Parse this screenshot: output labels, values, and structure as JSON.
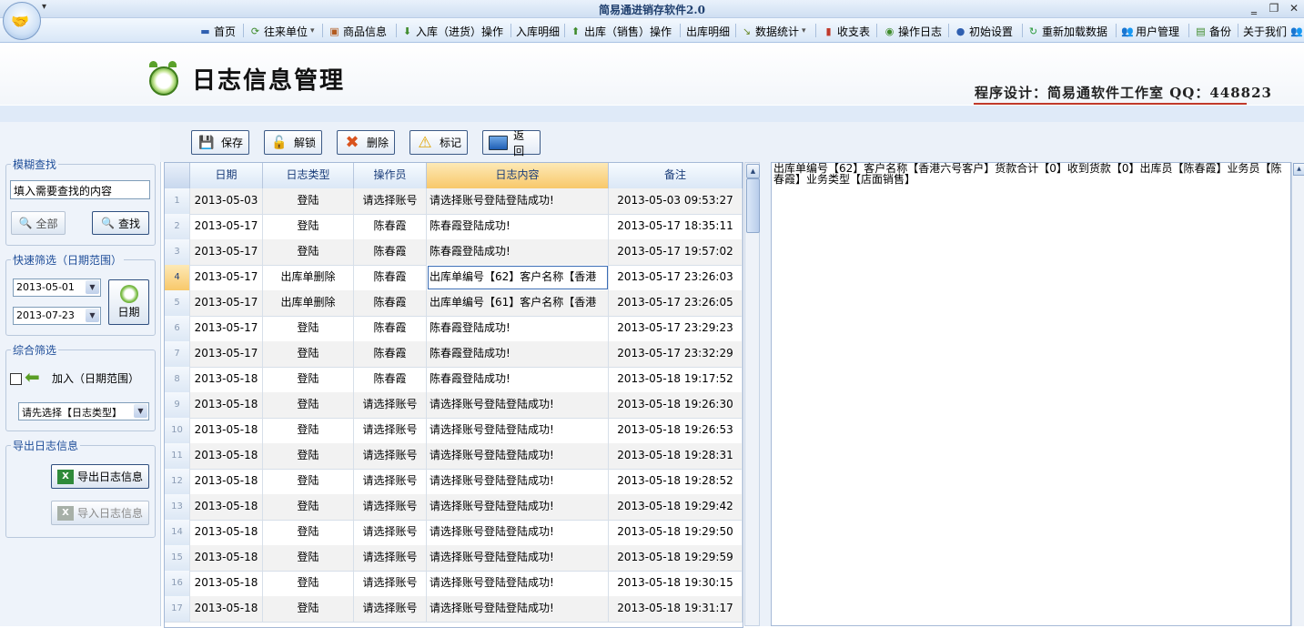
{
  "window": {
    "title": "简易通进销存软件2.0",
    "quick_access": "▾",
    "min": "‗",
    "max": "❐",
    "close": "✕"
  },
  "toolbar": {
    "items": [
      {
        "label": "首页",
        "icon": "home-icon",
        "color": "#2f5fb0"
      },
      {
        "label": "往来单位",
        "icon": "contacts-icon",
        "color": "#3d8a2a",
        "dropdown": true
      },
      {
        "label": "商品信息",
        "icon": "goods-icon",
        "color": "#b25a1e"
      },
      {
        "label": "入库（进货）操作",
        "icon": "down-arrow-icon",
        "color": "#3d8a2a"
      },
      {
        "label": "入库明细",
        "icon": "",
        "color": ""
      },
      {
        "label": "出库（销售）操作",
        "icon": "up-arrow-icon",
        "color": "#3d8a2a"
      },
      {
        "label": "出库明细",
        "icon": "",
        "color": ""
      },
      {
        "label": "数据统计",
        "icon": "stats-icon",
        "color": "#6a8a2a",
        "dropdown": true
      },
      {
        "label": "收支表",
        "icon": "bar-chart-icon",
        "color": "#c0392b"
      },
      {
        "label": "操作日志",
        "icon": "clock-icon",
        "color": "#3d8a2a"
      },
      {
        "label": "初始设置",
        "icon": "settings-icon",
        "color": "#2f5fb0"
      },
      {
        "label": "重新加载数据",
        "icon": "reload-icon",
        "color": "#2a9a3a"
      },
      {
        "label": "用户管理",
        "icon": "users-icon",
        "color": "#2f5fb0"
      },
      {
        "label": "备份",
        "icon": "backup-icon",
        "color": "#3d8a2a"
      },
      {
        "label": "关于我们",
        "icon": "",
        "color": ""
      }
    ]
  },
  "header": {
    "title": "日志信息管理",
    "credit": "程序设计：简易通软件工作室 QQ：448823"
  },
  "sidebar": {
    "fuzzy": {
      "title": "模糊查找",
      "input_value": "填入需要查找的内容",
      "all_label": "全部",
      "find_label": "查找"
    },
    "quick": {
      "title": "快速筛选（日期范围）",
      "date_from": "2013-05-01",
      "date_to": "2013-07-23",
      "date_button": "日期"
    },
    "combined": {
      "title": "综合筛选",
      "add_label": "加入（日期范围）",
      "select_value": "请先选择【日志类型】"
    },
    "export": {
      "title": "导出日志信息",
      "export_label": "导出日志信息",
      "import_label": "导入日志信息"
    }
  },
  "actions": {
    "save": "保存",
    "unlock": "解锁",
    "delete": "删除",
    "mark": "标记",
    "back": "返回"
  },
  "grid": {
    "columns": [
      "日期",
      "日志类型",
      "操作员",
      "日志内容",
      "备注"
    ],
    "rows": [
      {
        "n": "1",
        "date": "2013-05-03",
        "type": "登陆",
        "op": "请选择账号",
        "content": "请选择账号登陆登陆成功!",
        "note": "2013-05-03 09:53:27"
      },
      {
        "n": "2",
        "date": "2013-05-17",
        "type": "登陆",
        "op": "陈春霞",
        "content": "陈春霞登陆成功!",
        "note": "2013-05-17 18:35:11"
      },
      {
        "n": "3",
        "date": "2013-05-17",
        "type": "登陆",
        "op": "陈春霞",
        "content": "陈春霞登陆成功!",
        "note": "2013-05-17 19:57:02"
      },
      {
        "n": "4",
        "date": "2013-05-17",
        "type": "出库单删除",
        "op": "陈春霞",
        "content": "出库单编号【62】客户名称【香港",
        "note": "2013-05-17 23:26:03"
      },
      {
        "n": "5",
        "date": "2013-05-17",
        "type": "出库单删除",
        "op": "陈春霞",
        "content": "出库单编号【61】客户名称【香港",
        "note": "2013-05-17 23:26:05"
      },
      {
        "n": "6",
        "date": "2013-05-17",
        "type": "登陆",
        "op": "陈春霞",
        "content": "陈春霞登陆成功!",
        "note": "2013-05-17 23:29:23"
      },
      {
        "n": "7",
        "date": "2013-05-17",
        "type": "登陆",
        "op": "陈春霞",
        "content": "陈春霞登陆成功!",
        "note": "2013-05-17 23:32:29"
      },
      {
        "n": "8",
        "date": "2013-05-18",
        "type": "登陆",
        "op": "陈春霞",
        "content": "陈春霞登陆成功!",
        "note": "2013-05-18 19:17:52"
      },
      {
        "n": "9",
        "date": "2013-05-18",
        "type": "登陆",
        "op": "请选择账号",
        "content": "请选择账号登陆登陆成功!",
        "note": "2013-05-18 19:26:30"
      },
      {
        "n": "10",
        "date": "2013-05-18",
        "type": "登陆",
        "op": "请选择账号",
        "content": "请选择账号登陆登陆成功!",
        "note": "2013-05-18 19:26:53"
      },
      {
        "n": "11",
        "date": "2013-05-18",
        "type": "登陆",
        "op": "请选择账号",
        "content": "请选择账号登陆登陆成功!",
        "note": "2013-05-18 19:28:31"
      },
      {
        "n": "12",
        "date": "2013-05-18",
        "type": "登陆",
        "op": "请选择账号",
        "content": "请选择账号登陆登陆成功!",
        "note": "2013-05-18 19:28:52"
      },
      {
        "n": "13",
        "date": "2013-05-18",
        "type": "登陆",
        "op": "请选择账号",
        "content": "请选择账号登陆登陆成功!",
        "note": "2013-05-18 19:29:42"
      },
      {
        "n": "14",
        "date": "2013-05-18",
        "type": "登陆",
        "op": "请选择账号",
        "content": "请选择账号登陆登陆成功!",
        "note": "2013-05-18 19:29:50"
      },
      {
        "n": "15",
        "date": "2013-05-18",
        "type": "登陆",
        "op": "请选择账号",
        "content": "请选择账号登陆登陆成功!",
        "note": "2013-05-18 19:29:59"
      },
      {
        "n": "16",
        "date": "2013-05-18",
        "type": "登陆",
        "op": "请选择账号",
        "content": "请选择账号登陆登陆成功!",
        "note": "2013-05-18 19:30:15"
      },
      {
        "n": "17",
        "date": "2013-05-18",
        "type": "登陆",
        "op": "请选择账号",
        "content": "请选择账号登陆登陆成功!",
        "note": "2013-05-18 19:31:17"
      }
    ],
    "selected_row": "4"
  },
  "detail": {
    "text": "出库单编号【62】客户名称【香港六号客户】货款合计【0】收到货款【0】出库员【陈春霞】业务员【陈春霞】业务类型【店面销售】"
  }
}
